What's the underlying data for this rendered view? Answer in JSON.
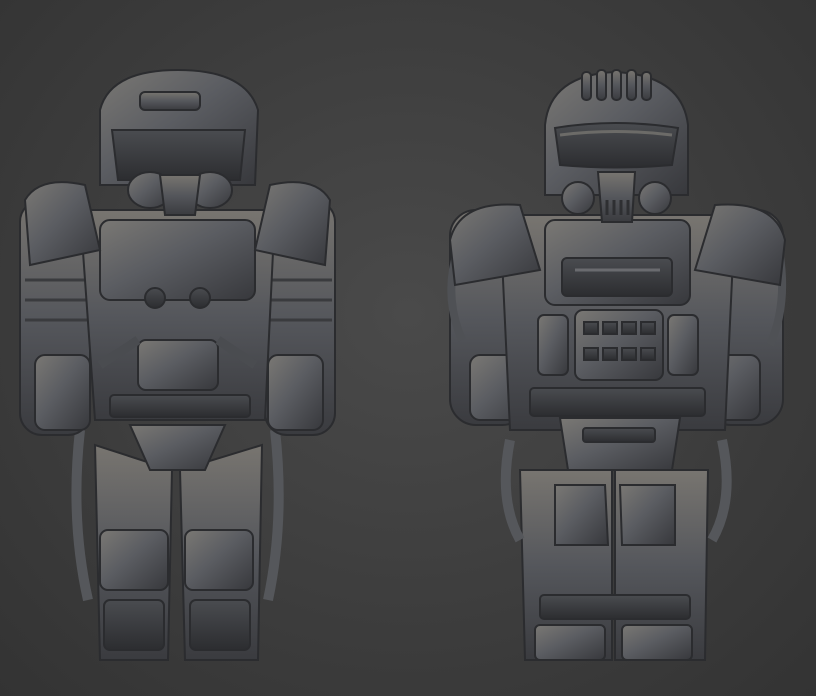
{
  "scene": {
    "background_color": "#3f3f3f",
    "material_color": "#5a5c62",
    "highlight_color": "#8a8580",
    "shadow_color": "#2a2b2e",
    "models": [
      {
        "name": "armored-figure-left",
        "style": "heavy power armor with round helmet and gas-mask respirator"
      },
      {
        "name": "armored-figure-right",
        "style": "trooper armor with ridged helmet, visor and chest plate carrier"
      }
    ]
  }
}
